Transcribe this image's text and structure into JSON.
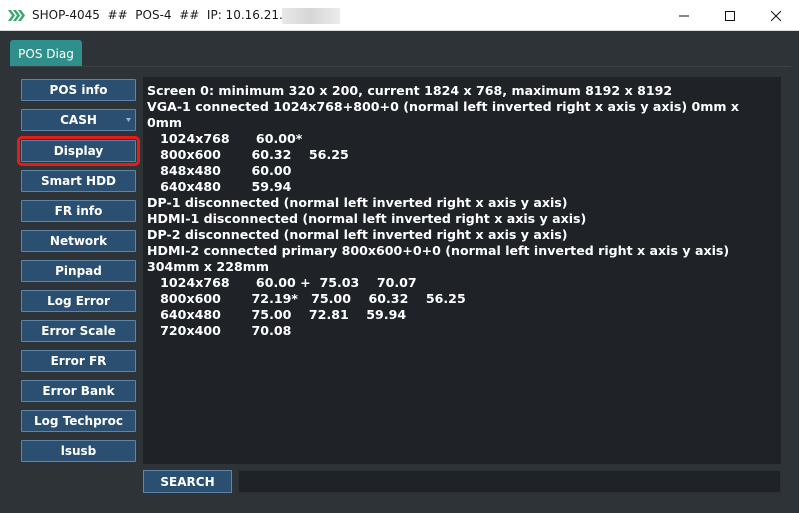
{
  "window": {
    "title": "SHOP-4045  ##  POS-4  ##  IP: 10.16.21.147  ##",
    "app_icon": "app-stripes-icon",
    "controls": {
      "minimize": "minimize-icon",
      "maximize": "maximize-icon",
      "close": "close-icon"
    }
  },
  "tabs": [
    {
      "label": "POS Diag"
    }
  ],
  "sidebar": {
    "items": [
      {
        "label": "POS info"
      },
      {
        "label": "CASH"
      },
      {
        "label": "Display"
      },
      {
        "label": "Smart HDD"
      },
      {
        "label": "FR info"
      },
      {
        "label": "Network"
      },
      {
        "label": "Pinpad"
      },
      {
        "label": "Log Error"
      },
      {
        "label": "Error Scale"
      },
      {
        "label": "Error FR"
      },
      {
        "label": "Error Bank"
      },
      {
        "label": "Log Techproc"
      },
      {
        "label": "lsusb"
      }
    ],
    "selected": "Display"
  },
  "output": {
    "text": "Screen 0: minimum 320 x 200, current 1824 x 768, maximum 8192 x 8192\nVGA-1 connected 1024x768+800+0 (normal left inverted right x axis y axis) 0mm x 0mm\n   1024x768      60.00*\n   800x600       60.32    56.25\n   848x480       60.00\n   640x480       59.94\nDP-1 disconnected (normal left inverted right x axis y axis)\nHDMI-1 disconnected (normal left inverted right x axis y axis)\nDP-2 disconnected (normal left inverted right x axis y axis)\nHDMI-2 connected primary 800x600+0+0 (normal left inverted right x axis y axis) 304mm x 228mm\n   1024x768      60.00 +  75.03    70.07\n   800x600       72.19*   75.00    60.32    56.25\n   640x480       75.00    72.81    59.94\n   720x400       70.08"
  },
  "search": {
    "button_label": "SEARCH",
    "value": ""
  },
  "colors": {
    "background": "#2e3338",
    "output_bg": "#1f2327",
    "button_bg": "#2b4f70",
    "button_border": "#5f84a6",
    "tab_bg": "#2f8f8a",
    "selected_outline": "#e41c1c"
  }
}
